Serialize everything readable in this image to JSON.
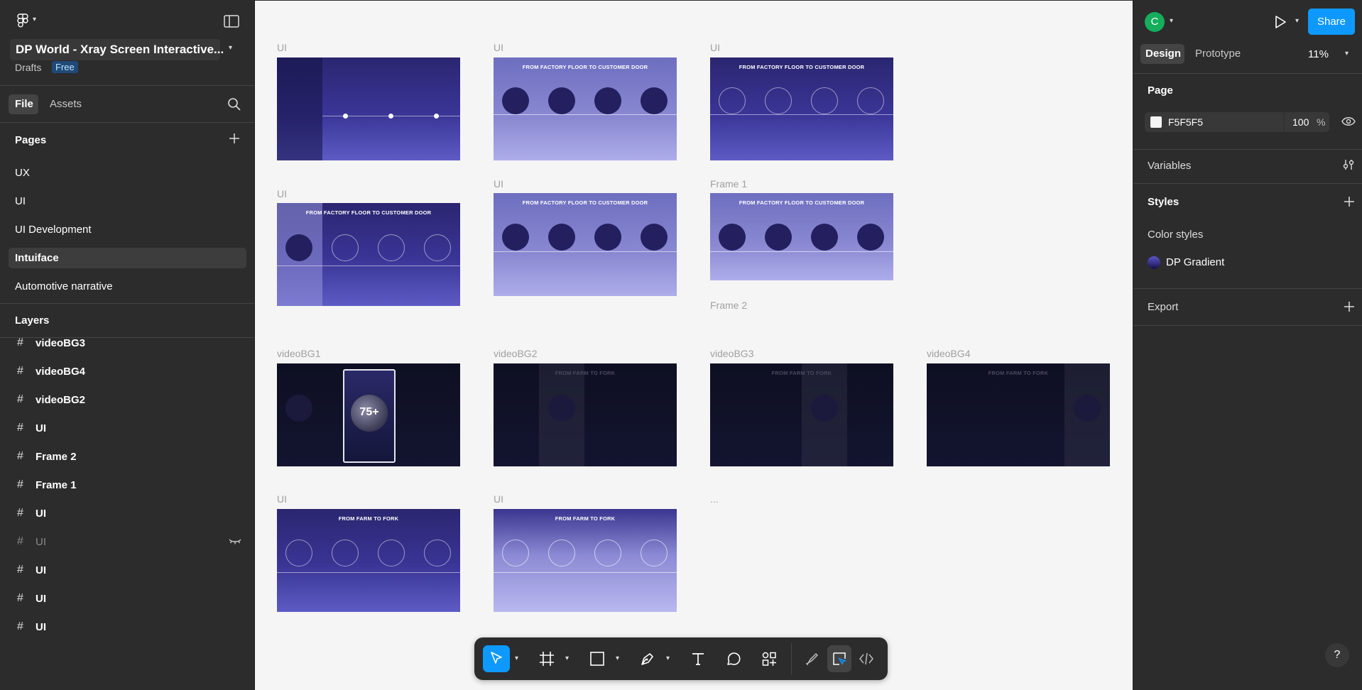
{
  "app": {
    "file_title": "DP World - Xray Screen Interactive...",
    "drafts_label": "Drafts",
    "plan_badge": "Free",
    "tabs": {
      "file": "File",
      "assets": "Assets"
    },
    "pages_heading": "Pages",
    "pages": [
      "UX",
      "UI",
      "UI Development",
      "Intuiface",
      "Automotive narrative"
    ],
    "layers_heading": "Layers",
    "layers": [
      "videoBG3",
      "videoBG4",
      "videoBG2",
      "UI",
      "Frame 2",
      "Frame 1",
      "UI",
      "UI",
      "UI",
      "UI",
      "UI"
    ]
  },
  "right_panel": {
    "avatar_letter": "C",
    "share_label": "Share",
    "tabs": {
      "design": "Design",
      "prototype": "Prototype"
    },
    "zoom": "11%",
    "page_heading": "Page",
    "page_color": "F5F5F5",
    "page_opacity": "100",
    "percent_sign": "%",
    "variables_heading": "Variables",
    "styles_heading": "Styles",
    "color_styles_heading": "Color styles",
    "color_style_name": "DP Gradient",
    "export_heading": "Export",
    "help": "?"
  },
  "canvas": {
    "frame_labels": {
      "r1c1": "UI",
      "r1c2": "UI",
      "r1c3": "UI",
      "r2c1": "UI",
      "r2c2": "UI",
      "r2c3": "Frame 1",
      "r2c3b": "Frame 2",
      "r3c1": "videoBG1",
      "r3c2": "videoBG2",
      "r3c3": "videoBG3",
      "r3c4": "videoBG4",
      "r4c1": "UI",
      "r4c2": "UI",
      "r4c3": "..."
    },
    "factory_title": "FROM FACTORY FLOOR TO CUSTOMER DOOR",
    "farm_title": "FROM FARM TO FORK",
    "phone_stat": "75+"
  },
  "colors": {
    "accent": "#0d99ff",
    "share_bg": "#0d99ff",
    "avatar_bg": "#14ae5c",
    "panel_bg": "#2c2c2c"
  },
  "icons": [
    "figma-menu-icon",
    "sidebar-toggle-icon",
    "search-icon",
    "plus-icon",
    "hash-icon",
    "eye-closed-icon",
    "play-icon",
    "eye-icon",
    "variables-icon",
    "move-tool-icon",
    "frame-tool-icon",
    "rectangle-tool-icon",
    "pen-tool-icon",
    "text-tool-icon",
    "comment-tool-icon",
    "actions-icon",
    "draw-mode-icon",
    "design-mode-icon",
    "dev-mode-icon"
  ]
}
